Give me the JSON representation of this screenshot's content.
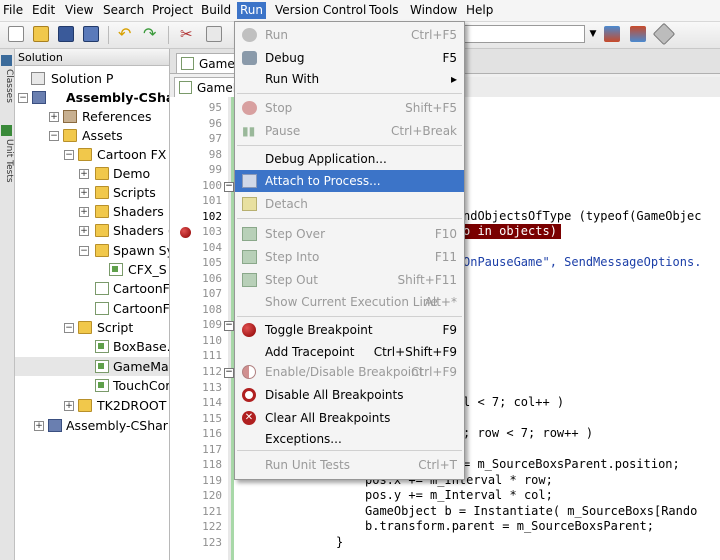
{
  "menubar": [
    "File",
    "Edit",
    "View",
    "Search",
    "Project",
    "Build",
    "Run",
    "Version Control",
    "Tools",
    "Window",
    "Help"
  ],
  "toolbar": {
    "config_value": "ug"
  },
  "side_tabs": {
    "classes": "Classes",
    "unit_tests": "Unit Tests"
  },
  "solution": {
    "header": "Solution",
    "tree": [
      {
        "label": "Solution P"
      },
      {
        "label": "Assembly-CShar"
      },
      {
        "label": "References"
      },
      {
        "label": "Assets"
      },
      {
        "label": "Cartoon FX"
      },
      {
        "label": "Demo"
      },
      {
        "label": "Scripts"
      },
      {
        "label": "Shaders"
      },
      {
        "label": "Shaders ("
      },
      {
        "label": "Spawn Sy"
      },
      {
        "label": "CFX_S"
      },
      {
        "label": "CartoonF"
      },
      {
        "label": "CartoonF"
      },
      {
        "label": "Script"
      },
      {
        "label": "BoxBase."
      },
      {
        "label": "GameMar"
      },
      {
        "label": "TouchCor"
      },
      {
        "label": "TK2DROOT"
      },
      {
        "label": "Assembly-CSharp"
      }
    ]
  },
  "editor": {
    "tab1": "GameM",
    "tab2": "GameM",
    "line_numbers": [
      "95",
      "96",
      "97",
      "98",
      "99",
      "100",
      "101",
      "102",
      "103",
      "104",
      "105",
      "106",
      "107",
      "108",
      "109",
      "110",
      "111",
      "112",
      "113",
      "114",
      "115",
      "116",
      "117",
      "118",
      "119",
      "120",
      "121",
      "122",
      "123"
    ],
    "code_lines": [
      {
        "line": "102",
        "text": "ndObjectsOfType (typeof(GameObjec"
      },
      {
        "line": "103",
        "text": "o in objects)"
      },
      {
        "line": "105",
        "text": "OnPauseGame\", SendMessageOptions."
      },
      {
        "line": "114",
        "text": "l < 7; col++ )"
      },
      {
        "line": "116",
        "text": "; row < 7; row++ )"
      },
      {
        "line": "118",
        "text": "= m_SourceBoxsParent.position;"
      },
      {
        "line": "119",
        "text": "pos.x += m_Interval * row;"
      },
      {
        "line": "120",
        "text": "pos.y += m_Interval * col;"
      },
      {
        "line": "121",
        "text": "GameObject b = Instantiate( m_SourceBoxs[Rando"
      },
      {
        "line": "122",
        "text": "b.transform.parent = m_SourceBoxsParent;"
      },
      {
        "line": "123",
        "text": "}"
      }
    ]
  },
  "run_menu": {
    "items": [
      {
        "label": "Run",
        "shortcut": "Ctrl+F5",
        "icon": "run-icon"
      },
      {
        "label": "Debug",
        "shortcut": "F5",
        "icon": "debug-icon"
      },
      {
        "label": "Run With",
        "shortcut": "▸"
      },
      {
        "label": "Stop",
        "shortcut": "Shift+F5",
        "icon": "stop-icon"
      },
      {
        "label": "Pause",
        "shortcut": "Ctrl+Break",
        "icon": "pause-icon"
      },
      {
        "label": "Debug Application..."
      },
      {
        "label": "Attach to Process...",
        "icon": "attach-icon"
      },
      {
        "label": "Detach",
        "icon": "detach-icon"
      },
      {
        "label": "Step Over",
        "shortcut": "F10",
        "icon": "step-over-icon"
      },
      {
        "label": "Step Into",
        "shortcut": "F11",
        "icon": "step-into-icon"
      },
      {
        "label": "Step Out",
        "shortcut": "Shift+F11",
        "icon": "step-out-icon"
      },
      {
        "label": "Show Current Execution Line",
        "shortcut": "Alt+*"
      },
      {
        "label": "Toggle Breakpoint",
        "shortcut": "F9",
        "icon": "breakpoint-icon"
      },
      {
        "label": "Add Tracepoint",
        "shortcut": "Ctrl+Shift+F9"
      },
      {
        "label": "Enable/Disable Breakpoint",
        "shortcut": "Ctrl+F9",
        "icon": "enable-disable-breakpoint-icon"
      },
      {
        "label": "Disable All Breakpoints",
        "icon": "disable-all-breakpoints-icon"
      },
      {
        "label": "Clear All Breakpoints",
        "icon": "clear-breakpoints-icon"
      },
      {
        "label": "Exceptions..."
      },
      {
        "label": "Run Unit Tests",
        "shortcut": "Ctrl+T"
      }
    ]
  }
}
